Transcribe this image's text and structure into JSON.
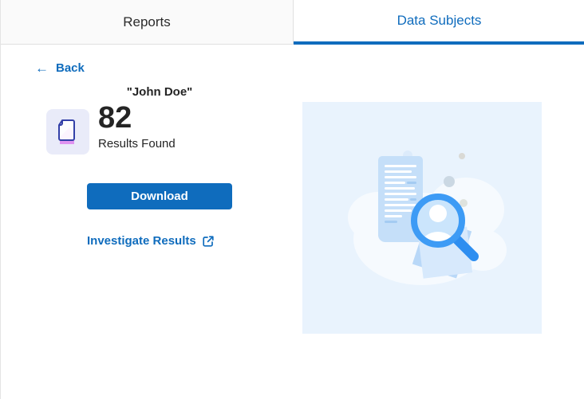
{
  "tabs": [
    {
      "label": "Reports",
      "active": false
    },
    {
      "label": "Data Subjects",
      "active": true
    }
  ],
  "back": {
    "arrow": "←",
    "label": "Back"
  },
  "results": {
    "query": "\"John Doe\"",
    "count": "82",
    "count_label": "Results Found",
    "icon": "document-icon"
  },
  "actions": {
    "download_label": "Download",
    "investigate_label": "Investigate Results",
    "investigate_icon": "external-link-icon"
  },
  "illustration": {
    "name": "person-search-illustration"
  },
  "colors": {
    "accent_blue": "#0f6cbd",
    "inactive_tab_bg": "#fafafa",
    "panel_bg": "#e9f3fd",
    "tile_bg": "#e9ebf9",
    "tile_glyph_outline": "#3340a8",
    "tile_glyph_magenta": "#df93f0",
    "text_dark": "#242424"
  }
}
